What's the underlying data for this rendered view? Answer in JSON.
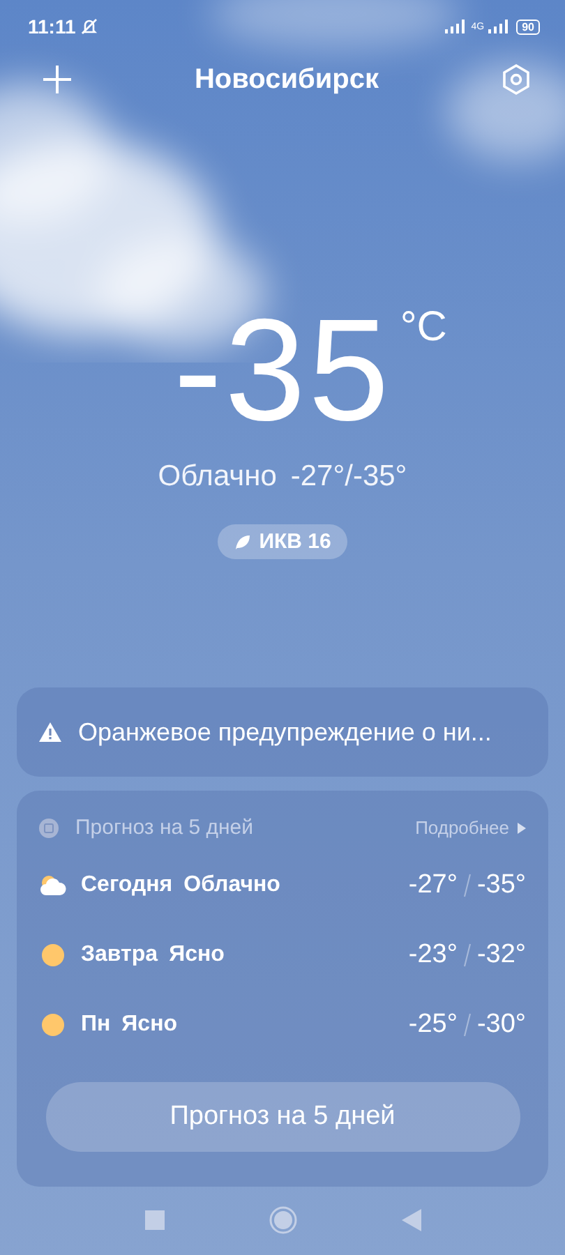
{
  "status_bar": {
    "time": "11:11",
    "network": "4G",
    "battery": "90"
  },
  "header": {
    "city": "Новосибирск"
  },
  "current": {
    "temperature": "-35",
    "unit": "°C",
    "condition": "Облачно",
    "range": "-27°/-35°",
    "aqi": "ИКВ 16"
  },
  "warning": {
    "text": "Оранжевое предупреждение о ни..."
  },
  "forecast": {
    "title": "Прогноз на 5 дней",
    "more": "Подробнее",
    "days": [
      {
        "kind": "cloudy",
        "day": "Сегодня",
        "condition": "Облачно",
        "high": "-27°",
        "low": "-35°"
      },
      {
        "kind": "clear",
        "day": "Завтра",
        "condition": "Ясно",
        "high": "-23°",
        "low": "-32°"
      },
      {
        "kind": "clear",
        "day": "Пн",
        "condition": "Ясно",
        "high": "-25°",
        "low": "-30°"
      }
    ],
    "button": "Прогноз на 5 дней"
  }
}
